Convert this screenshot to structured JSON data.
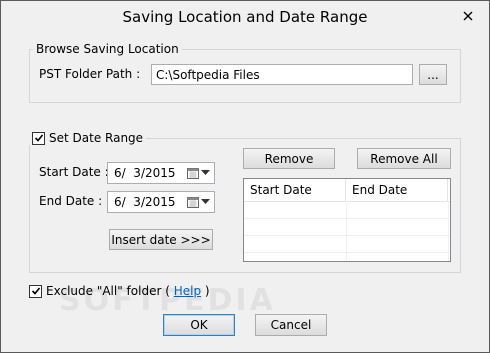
{
  "window": {
    "title": "Saving Location and Date Range"
  },
  "browse_group": {
    "label": "Browse Saving Location",
    "path_label": "PST Folder Path :",
    "path_value": "C:\\Softpedia Files",
    "browse_button": "..."
  },
  "date_group": {
    "checkbox_label": "Set Date Range",
    "checked": true,
    "start_label": "Start Date :",
    "start_value": "6/  3/2015",
    "end_label": "End Date :",
    "end_value": "6/  3/2015",
    "insert_button": "Insert date >>>",
    "remove_button": "Remove",
    "remove_all_button": "Remove All",
    "list_columns": [
      "Start Date",
      "End Date"
    ]
  },
  "exclude": {
    "checked": true,
    "prefix": "Exclude \"All\" folder (",
    "link": "Help",
    "suffix": ")"
  },
  "footer": {
    "ok": "OK",
    "cancel": "Cancel"
  },
  "watermark": "SOFTPEDIA"
}
